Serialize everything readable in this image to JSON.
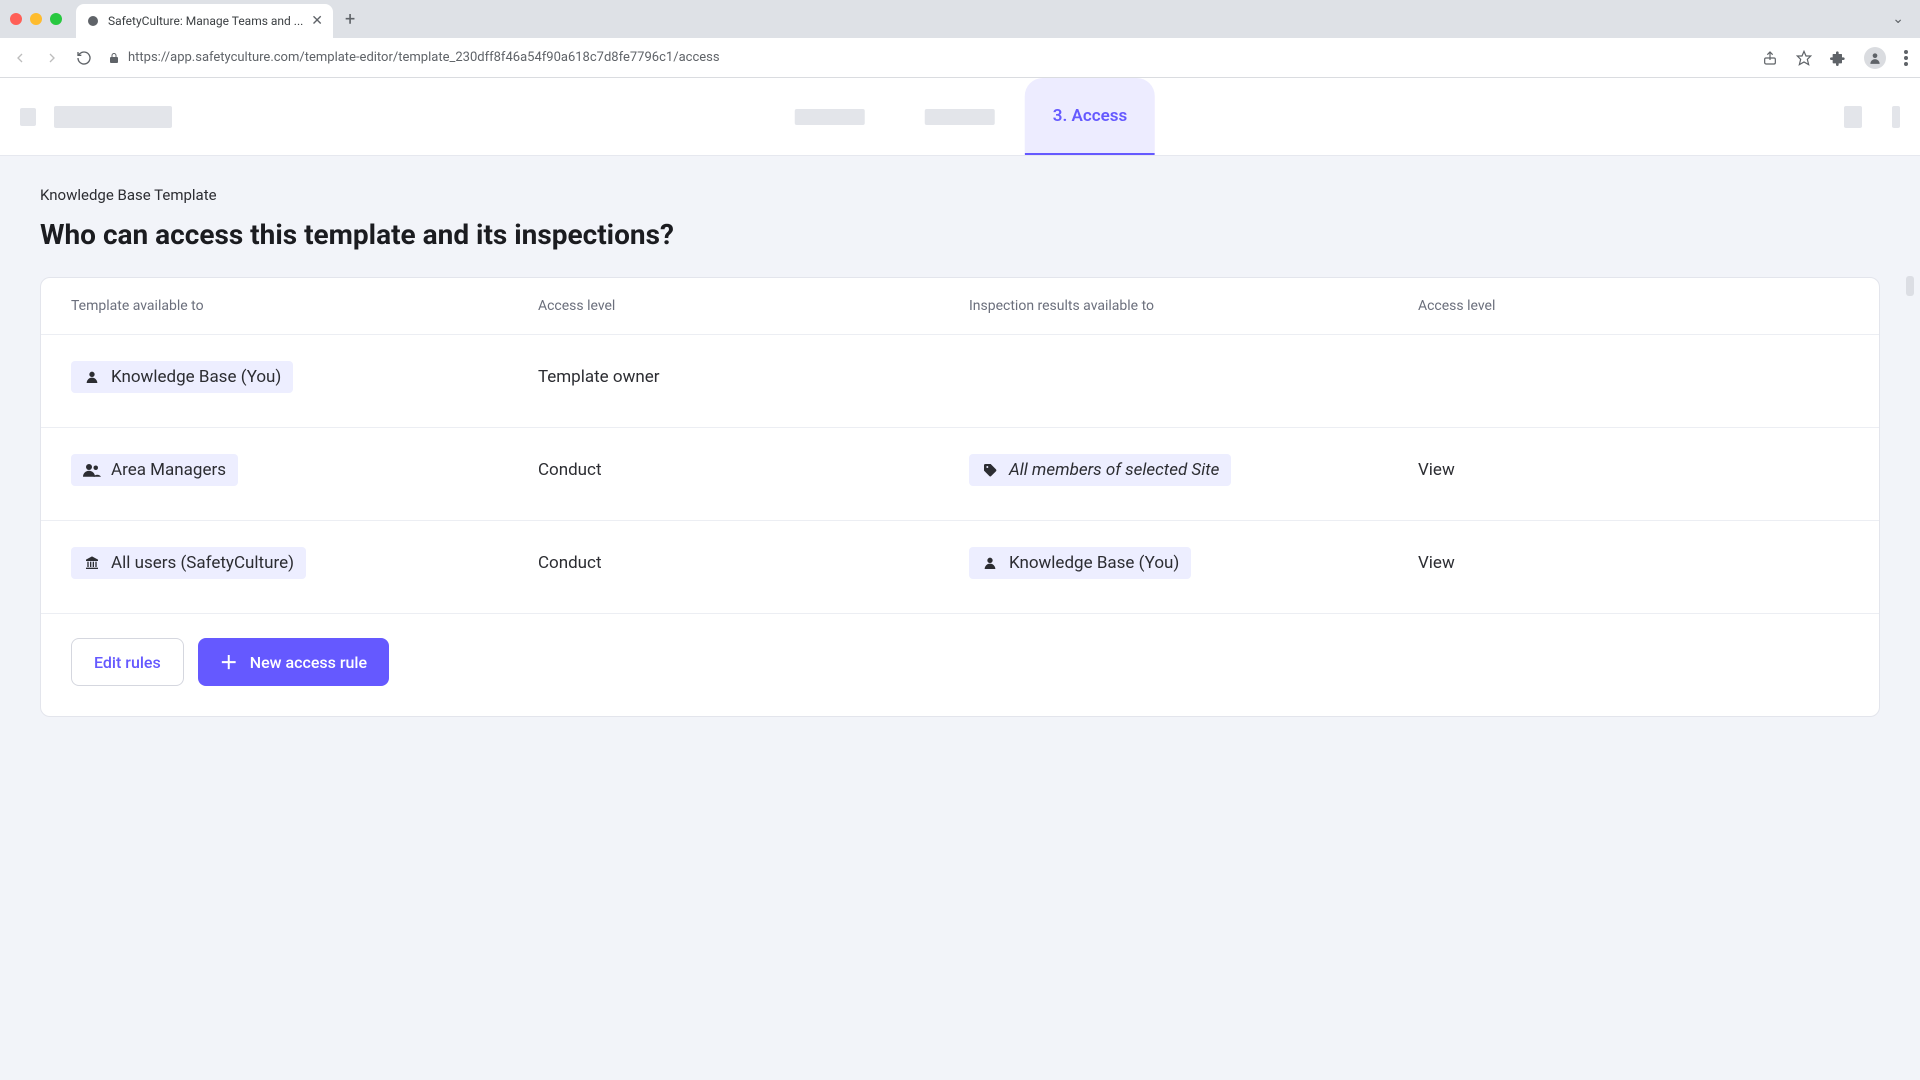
{
  "browser": {
    "tab_title": "SafetyCulture: Manage Teams and ...",
    "url": "https://app.safetyculture.com/template-editor/template_230dff8f46a54f90a618c7d8fe7796c1/access"
  },
  "nav": {
    "active_tab_label": "3. Access"
  },
  "page": {
    "breadcrumb": "Knowledge Base Template",
    "heading": "Who can access this template and its inspections?"
  },
  "table": {
    "headers": {
      "col1": "Template available to",
      "col2": "Access level",
      "col3": "Inspection results available to",
      "col4": "Access level"
    },
    "rows": [
      {
        "template_to_icon": "person",
        "template_to": "Knowledge Base (You)",
        "template_level": "Template owner",
        "results_to_icon": "",
        "results_to": "",
        "results_level": ""
      },
      {
        "template_to_icon": "group",
        "template_to": "Area Managers",
        "template_level": "Conduct",
        "results_to_icon": "tag",
        "results_to": "All members of selected Site",
        "results_to_italic": true,
        "results_level": "View"
      },
      {
        "template_to_icon": "org",
        "template_to": "All users (SafetyCulture)",
        "template_level": "Conduct",
        "results_to_icon": "person",
        "results_to": "Knowledge Base (You)",
        "results_level": "View"
      }
    ]
  },
  "actions": {
    "edit": "Edit rules",
    "new": "New access rule"
  }
}
